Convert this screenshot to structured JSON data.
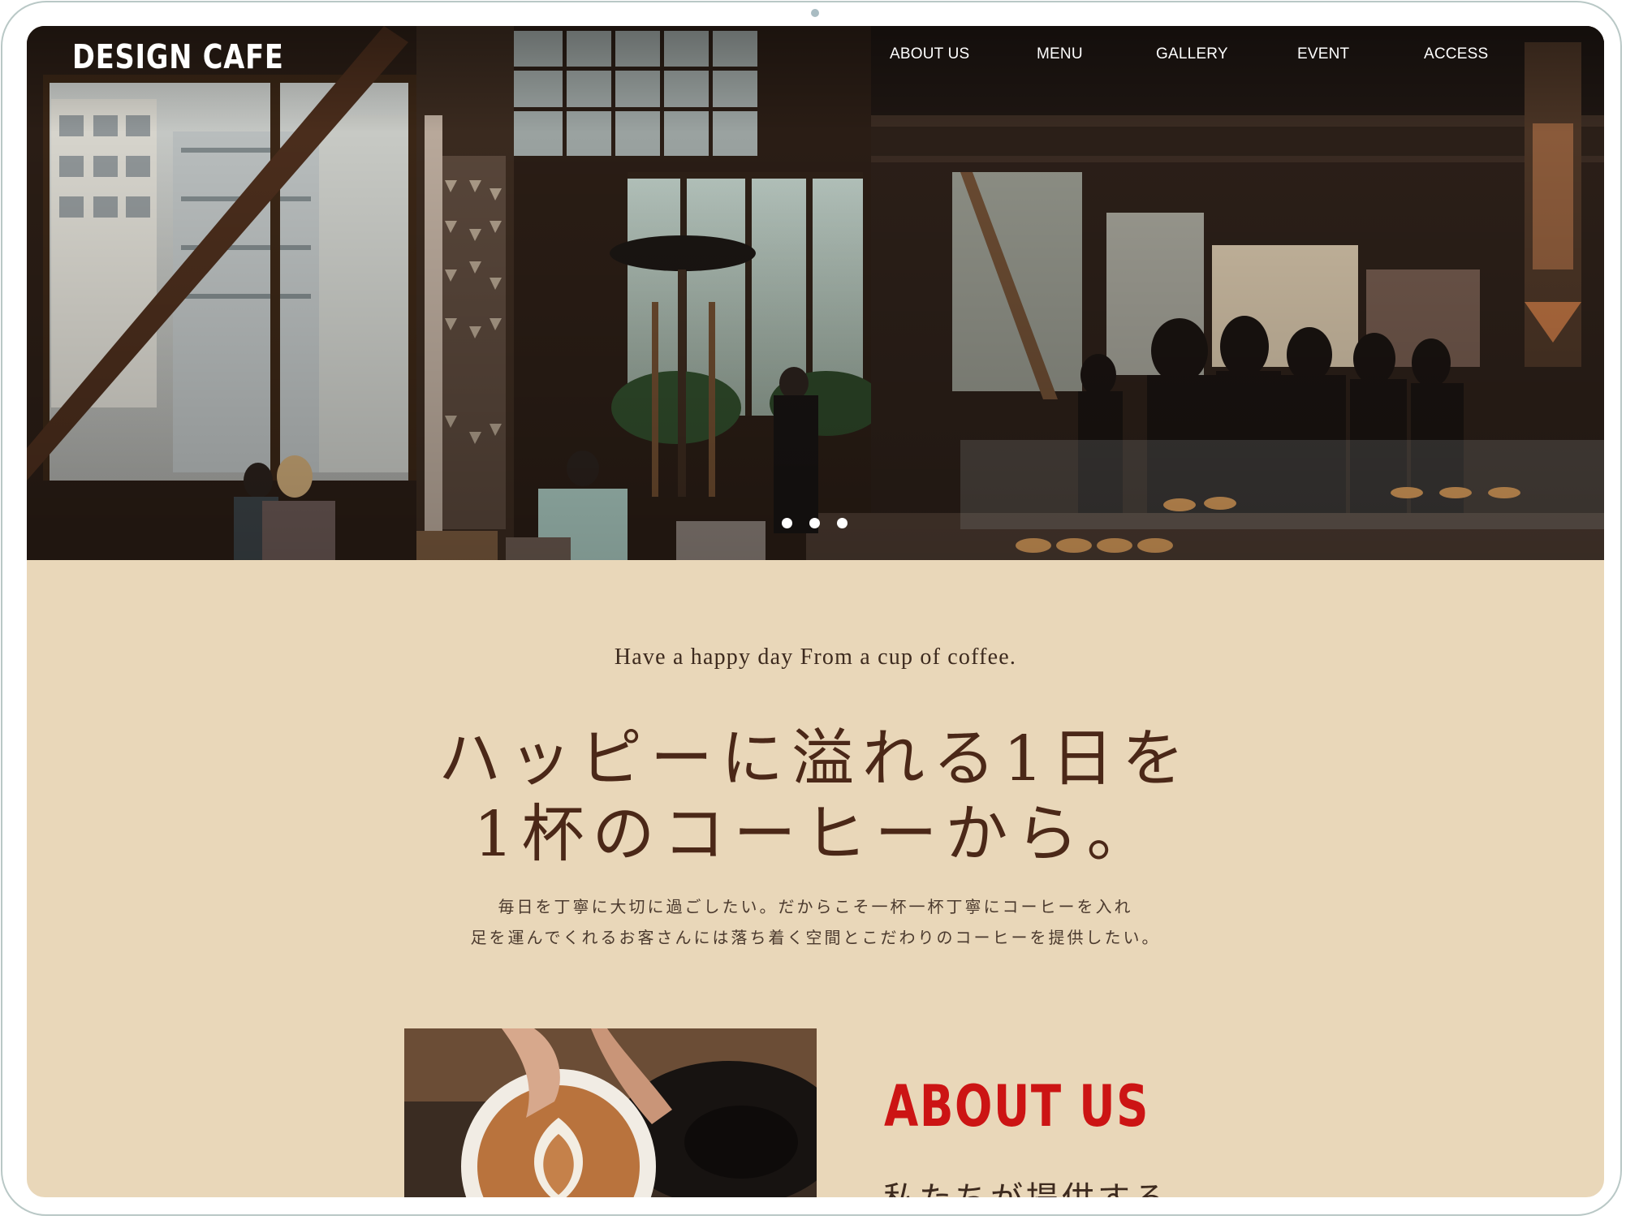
{
  "brand": {
    "logo": "DESIGN CAFE"
  },
  "nav": {
    "items": [
      "ABOUT US",
      "MENU",
      "GALLERY",
      "EVENT",
      "ACCESS"
    ]
  },
  "hero": {
    "slide_count": 3,
    "active_slide": 1
  },
  "intro": {
    "tagline": "Have a happy day From a cup of coffee.",
    "headline_line1": "ハッピーに溢れる1日を",
    "headline_line2": "1杯のコーヒーから。",
    "body_line1": "毎日を丁寧に大切に過ごしたい。だからこそ一杯一杯丁寧にコーヒーを入れ",
    "body_line2": "足を運んでくれるお客さんには落ち着く空間とこだわりのコーヒーを提供したい。"
  },
  "about": {
    "heading": "ABOUT US",
    "subheading": "私たちが提供する"
  },
  "colors": {
    "page_bg": "#e9d7b9",
    "accent": "#cc1414",
    "headline": "#4b2818"
  }
}
